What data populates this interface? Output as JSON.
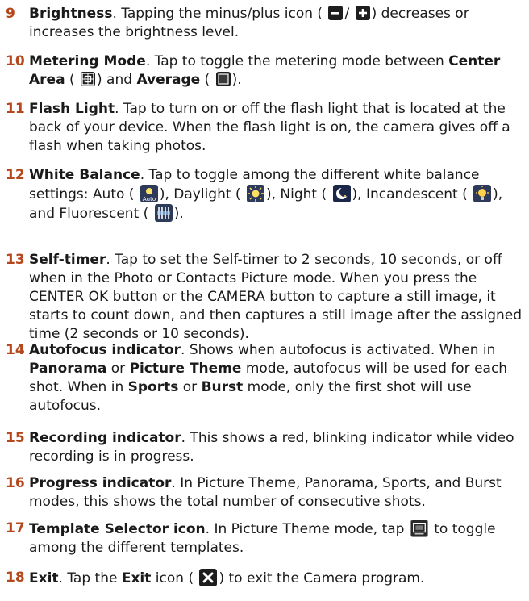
{
  "items": [
    {
      "num": "9",
      "term": "Brightness",
      "a": ". Tapping the minus/plus icon (",
      "sep": "/",
      "b": ") decreases or increases the brightness level.",
      "icons": [
        "minus-icon",
        "plus-icon"
      ]
    },
    {
      "num": "10",
      "term": "Metering Mode",
      "a": ". Tap to toggle the metering mode between ",
      "b1": "Center Area",
      "b": " (",
      "c": ") and ",
      "b2": "Average",
      "d": " (",
      "e": ").",
      "icons": [
        "center-area-metering-icon",
        "average-metering-icon"
      ]
    },
    {
      "num": "11",
      "term": "Flash Light",
      "a": ". Tap to turn on or off the flash light that is located at the back of your device. When the flash light is on, the camera gives off a flash when taking photos."
    },
    {
      "num": "12",
      "term": "White Balance",
      "a": ". Tap to toggle among the different white balance settings: Auto (",
      "b": "), Daylight (",
      "c": "), Night (",
      "d": "), Incandescent (",
      "e": "), and Fluorescent (",
      "f": ").",
      "icons": [
        "auto-wb-icon",
        "daylight-wb-icon",
        "night-wb-icon",
        "incandescent-wb-icon",
        "fluorescent-wb-icon"
      ]
    },
    {
      "num": "13",
      "term": "Self-timer",
      "a": ". Tap to set the Self-timer to 2 seconds, 10 seconds, or off when in the Photo or Contacts Picture mode. When you press the CENTER OK button or the CAMERA button to capture a still image, it starts to count down, and then captures a still image after the assigned time (2 seconds or 10 seconds)."
    },
    {
      "num": "14",
      "term": "Autofocus indicator",
      "a": ". Shows when autofocus is activated. When in ",
      "b1": "Panorama",
      "b": " or ",
      "b2": "Picture Theme",
      "c": " mode, autofocus will be used for each shot. When in ",
      "b3": "Sports",
      "d": " or ",
      "b4": "Burst",
      "e": " mode, only the first shot will use autofocus."
    },
    {
      "num": "15",
      "term": "Recording indicator",
      "a": ". This shows a red, blinking indicator while video recording is in progress."
    },
    {
      "num": "16",
      "term": "Progress indicator",
      "a": ". In Picture Theme, Panorama, Sports, and Burst modes, this shows the total number of consecutive shots."
    },
    {
      "num": "17",
      "term": "Template Selector icon",
      "a": ". In Picture Theme mode, tap ",
      "b": " to toggle among the different templates.",
      "icons": [
        "template-selector-icon"
      ]
    },
    {
      "num": "18",
      "term": "Exit",
      "a": ". Tap the ",
      "b1": "Exit",
      "b": " icon (",
      "c": ") to exit the Camera program.",
      "icons": [
        "exit-icon"
      ]
    }
  ],
  "colors": {
    "number": "#b5471c",
    "text": "#1a1a1a",
    "icon_dark": "#1e1e1e"
  }
}
